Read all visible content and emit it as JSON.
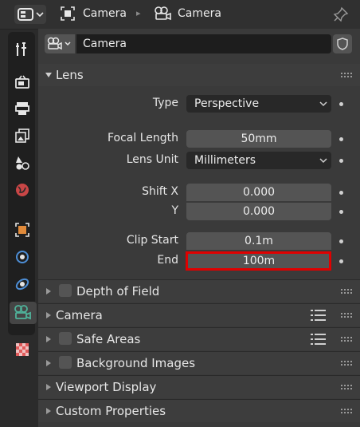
{
  "header": {
    "breadcrumb": [
      "Camera",
      "Camera"
    ],
    "icons": [
      "editor-type-icon",
      "object-data-icon",
      "camera-icon",
      "pin-icon"
    ]
  },
  "sidebar": {
    "tabs": [
      "tool",
      "render",
      "output",
      "view-layer",
      "scene",
      "world",
      "object",
      "physics",
      "constraints",
      "object-data-camera",
      "texture"
    ],
    "active": "object-data-camera"
  },
  "datablock": {
    "name": "Camera"
  },
  "lens": {
    "title": "Lens",
    "type_label": "Type",
    "type_value": "Perspective",
    "focal_length_label": "Focal Length",
    "focal_length_value": "50mm",
    "lens_unit_label": "Lens Unit",
    "lens_unit_value": "Millimeters",
    "shift_x_label": "Shift X",
    "shift_x_value": "0.000",
    "shift_y_label": "Y",
    "shift_y_value": "0.000",
    "clip_start_label": "Clip Start",
    "clip_start_value": "0.1m",
    "clip_end_label": "End",
    "clip_end_value": "100m"
  },
  "sections": {
    "depth_of_field": "Depth of Field",
    "camera": "Camera",
    "safe_areas": "Safe Areas",
    "background_images": "Background Images",
    "viewport_display": "Viewport Display",
    "custom_properties": "Custom Properties"
  },
  "colors": {
    "highlight": "#e00000",
    "camera_tab_icon": "#4fb39a"
  }
}
